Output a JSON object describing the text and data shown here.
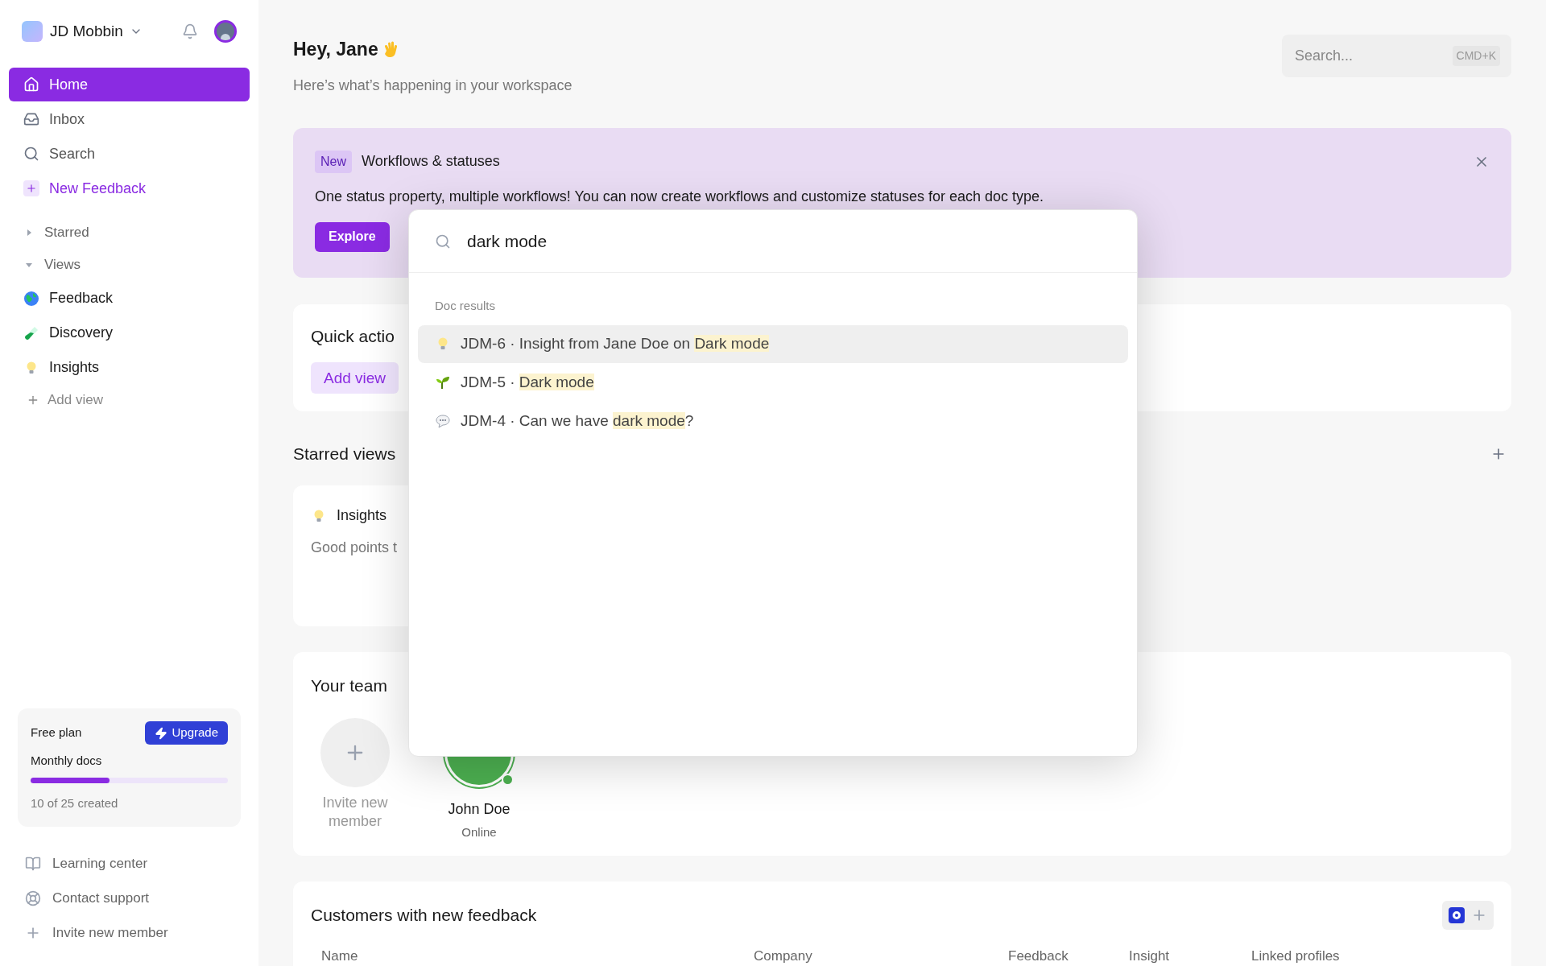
{
  "workspace": {
    "name": "JD Mobbin"
  },
  "sidebar": {
    "items": [
      {
        "label": "Home",
        "kind": "home",
        "selected": true
      },
      {
        "label": "Inbox",
        "kind": "inbox",
        "selected": false
      },
      {
        "label": "Search",
        "kind": "search",
        "selected": false
      },
      {
        "label": "New Feedback",
        "kind": "new",
        "selected": false
      }
    ],
    "sections": [
      {
        "label": "Starred",
        "expanded": false
      },
      {
        "label": "Views",
        "expanded": true
      }
    ],
    "views": [
      {
        "label": "Feedback",
        "kind": "globe"
      },
      {
        "label": "Discovery",
        "kind": "tube"
      },
      {
        "label": "Insights",
        "kind": "bulb"
      }
    ],
    "add_view": "Add view",
    "plan": {
      "title": "Free plan",
      "upgrade": "Upgrade",
      "label": "Monthly docs",
      "level": 0.4,
      "reading": "10 of 25 created"
    },
    "footer": [
      {
        "label": "Learning center",
        "kind": "book"
      },
      {
        "label": "Contact support",
        "kind": "support"
      },
      {
        "label": "Invite new member",
        "kind": "plus"
      }
    ]
  },
  "header": {
    "greeting": "Hey, Jane",
    "subtitle": "Here’s what’s happening in your workspace",
    "search": {
      "placeholder": "Search...",
      "shortcut": "CMD+K"
    }
  },
  "banner": {
    "badge": "New",
    "title": "Workflows & statuses",
    "text": "One status property, multiple workflows! You can now create workflows and customize statuses for each doc type.",
    "button": "Explore"
  },
  "quick_actions": {
    "title": "Quick actio",
    "button": "Add view"
  },
  "starred_views": {
    "title": "Starred views",
    "cards": [
      {
        "title": "Insights",
        "description": "Good points t"
      }
    ]
  },
  "team": {
    "title": "Your team",
    "invite": "Invite new member",
    "members": [
      {
        "name": "John Doe",
        "status": "Online",
        "color": "#4caf50"
      }
    ]
  },
  "customers": {
    "title": "Customers with new feedback",
    "columns": [
      "Name",
      "Company",
      "Feedback",
      "Insight",
      "Linked profiles"
    ]
  },
  "search_modal": {
    "query": "dark mode",
    "section": "Doc results",
    "results": [
      {
        "kind": "insight",
        "before": "JDM-6 · Insight from Jane Doe on ",
        "match": "Dark mode",
        "selected": true
      },
      {
        "kind": "sprout",
        "before": "JDM-5 · ",
        "match": "Dark mode",
        "selected": false
      },
      {
        "kind": "comment",
        "before": "JDM-4 · Can we have ",
        "match": "dark mode",
        "after": "?",
        "selected": false
      }
    ]
  }
}
